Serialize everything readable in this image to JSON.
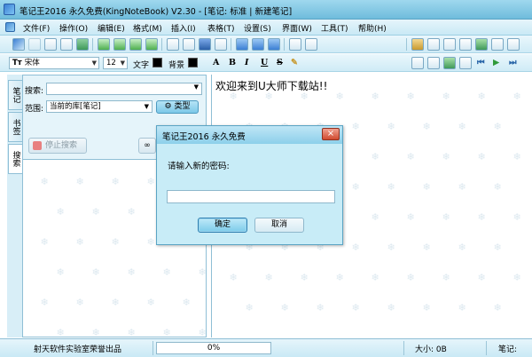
{
  "window": {
    "title": "笔记王2016 永久免费(KingNoteBook) V2.30 - [笔记: 标准 | 新建笔记]"
  },
  "menu": [
    "文件(F)",
    "操作(O)",
    "编辑(E)",
    "格式(M)",
    "插入(I)",
    "表格(T)",
    "设置(S)",
    "界面(W)",
    "工具(T)",
    "帮助(H)"
  ],
  "format_toolbar": {
    "font_name": "宋体",
    "font_size": "12",
    "text_color_label": "文字",
    "background_label": "背景",
    "text_color": "#000000",
    "background_color": "#000000"
  },
  "side_tabs": [
    "笔记",
    "书签",
    "搜索"
  ],
  "search_panel": {
    "search_label": "搜索:",
    "search_value": "",
    "scope_label": "范围:",
    "scope_value": "当前的库[笔记]",
    "type_button": "类型",
    "stop_button": "停止搜索"
  },
  "editor": {
    "content": "欢迎来到U大师下载站!!"
  },
  "statusbar": {
    "credit": "射天软件实验室荣誉出品",
    "progress": "0%",
    "size": "大小: 0B",
    "mode": "笔记:"
  },
  "dialog": {
    "title": "笔记王2016 永久免费",
    "close": "×",
    "prompt": "请输入新的密码:",
    "password_value": "",
    "ok": "确定",
    "cancel": "取消"
  },
  "colors": {
    "accent": "#8ccfea",
    "dialog_bg": "#c8ecf7",
    "close_button": "#d04a30"
  }
}
